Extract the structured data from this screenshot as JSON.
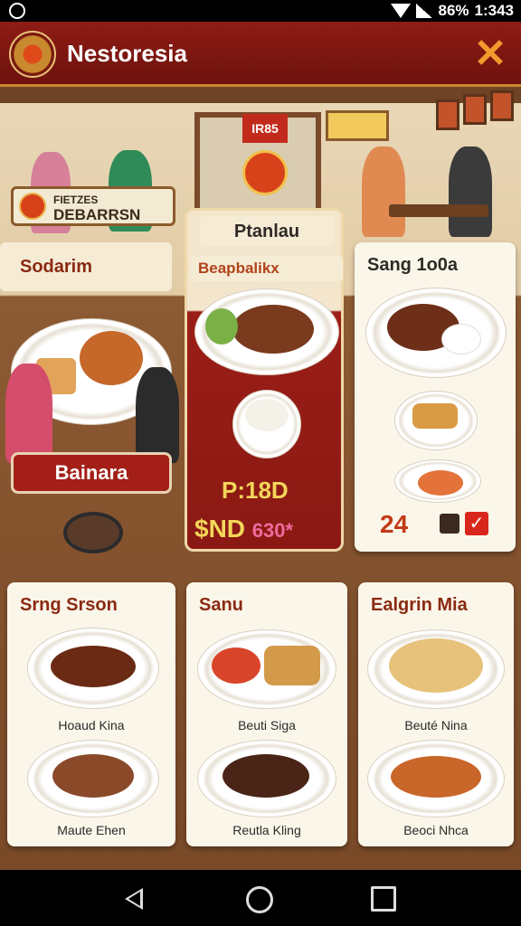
{
  "status_bar": {
    "battery": "86%",
    "time": "1:343"
  },
  "app_bar": {
    "title": "Nestoresia"
  },
  "scene_sign": {
    "line1": "FIETZES",
    "line2": "DEBARRSN"
  },
  "scene_board": {
    "text": "IR85"
  },
  "left_panel": {
    "top_label": "Sodarim",
    "bottom_label": "Bainara"
  },
  "promo": {
    "header": "Ptanlau",
    "subtitle": "Beapbalikx",
    "price1": "P:18D",
    "price2_main": "$ND",
    "price2_extra": "630*"
  },
  "right_card": {
    "title": "Sang 1o0a",
    "count": "24"
  },
  "menu_cards": [
    {
      "title": "Srng Srson",
      "items": [
        "Hoaud Kina",
        "Maute Ehen"
      ]
    },
    {
      "title": "Sanu",
      "items": [
        "Beuti Siga",
        "Reutla Kling"
      ]
    },
    {
      "title": "Ealgrin Mia",
      "items": [
        "Beuté Nina",
        "Beoci Nhca"
      ]
    }
  ],
  "colors": {
    "brand_red": "#8e1c14",
    "accent_orange": "#f29a2e",
    "gold_price": "#f4d65a"
  }
}
